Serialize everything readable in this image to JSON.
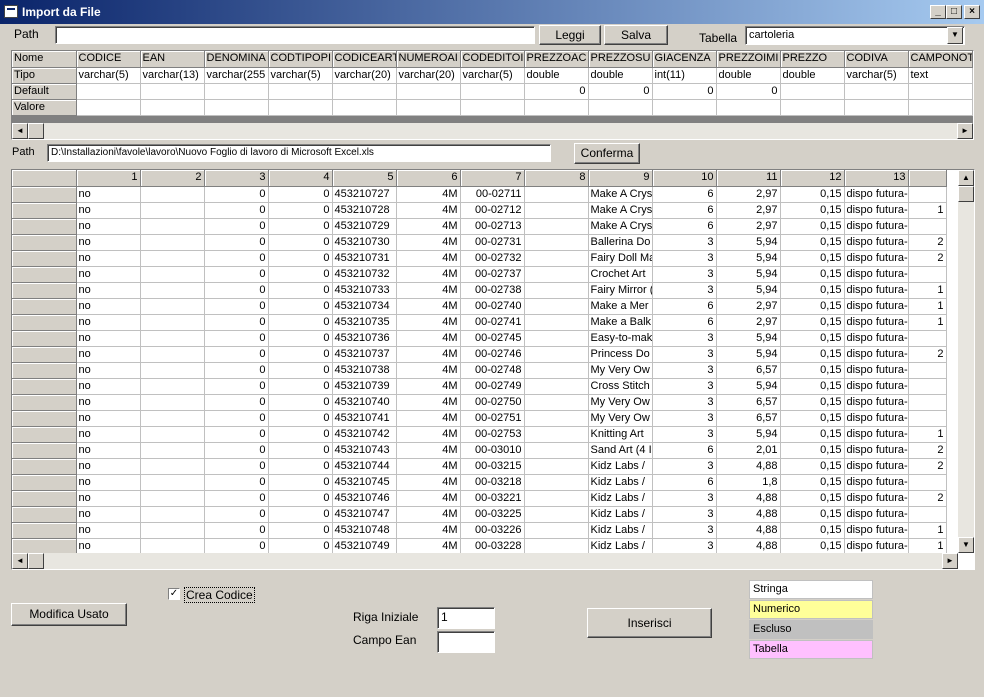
{
  "window": {
    "title": "Import da File"
  },
  "top": {
    "path_label": "Path",
    "path_value": "",
    "leggi_label": "Leggi",
    "salva_label": "Salva",
    "tabella_label": "Tabella",
    "tabella_value": "cartoleria"
  },
  "schema": {
    "row_labels": [
      "Nome",
      "Tipo",
      "Default",
      "Valore"
    ],
    "columns": [
      {
        "nome": "CODICE",
        "tipo": "varchar(5)",
        "default": ""
      },
      {
        "nome": "EAN",
        "tipo": "varchar(13)",
        "default": ""
      },
      {
        "nome": "DENOMINA",
        "tipo": "varchar(255",
        "default": ""
      },
      {
        "nome": "CODTIPOPI",
        "tipo": "varchar(5)",
        "default": ""
      },
      {
        "nome": "CODICEART",
        "tipo": "varchar(20)",
        "default": ""
      },
      {
        "nome": "NUMEROAI",
        "tipo": "varchar(20)",
        "default": ""
      },
      {
        "nome": "CODEDITOI",
        "tipo": "varchar(5)",
        "default": ""
      },
      {
        "nome": "PREZZOAC",
        "tipo": "double",
        "default": "0"
      },
      {
        "nome": "PREZZOSU",
        "tipo": "double",
        "default": "0"
      },
      {
        "nome": "GIACENZA",
        "tipo": "int(11)",
        "default": "0"
      },
      {
        "nome": "PREZZOIMI",
        "tipo": "double",
        "default": "0"
      },
      {
        "nome": "PREZZO",
        "tipo": "double",
        "default": ""
      },
      {
        "nome": "CODIVA",
        "tipo": "varchar(5)",
        "default": ""
      },
      {
        "nome": "CAMPONOT",
        "tipo": "text",
        "default": ""
      }
    ]
  },
  "file": {
    "path_label": "Path",
    "path_value": "D:\\Installazioni\\favole\\lavoro\\Nuovo Foglio di lavoro di Microsoft Excel.xls",
    "conferma_label": "Conferma"
  },
  "data": {
    "headers": [
      "",
      "1",
      "2",
      "3",
      "4",
      "5",
      "6",
      "7",
      "8",
      "9",
      "10",
      "11",
      "12",
      "13",
      ""
    ],
    "rows": [
      [
        "",
        "no",
        "",
        "0",
        "0",
        "453210727",
        "4M",
        "00-02711",
        "",
        "Make A Crys",
        "6",
        "2,97",
        "0,15",
        "dispo futura-",
        ""
      ],
      [
        "",
        "no",
        "",
        "0",
        "0",
        "453210728",
        "4M",
        "00-02712",
        "",
        "Make A Crys",
        "6",
        "2,97",
        "0,15",
        "dispo futura-",
        "1"
      ],
      [
        "",
        "no",
        "",
        "0",
        "0",
        "453210729",
        "4M",
        "00-02713",
        "",
        "Make A Crys",
        "6",
        "2,97",
        "0,15",
        "dispo futura-",
        ""
      ],
      [
        "",
        "no",
        "",
        "0",
        "0",
        "453210730",
        "4M",
        "00-02731",
        "",
        "Ballerina Do",
        "3",
        "5,94",
        "0,15",
        "dispo futura-",
        "2"
      ],
      [
        "",
        "no",
        "",
        "0",
        "0",
        "453210731",
        "4M",
        "00-02732",
        "",
        "Fairy Doll Ma",
        "3",
        "5,94",
        "0,15",
        "dispo futura-",
        "2"
      ],
      [
        "",
        "no",
        "",
        "0",
        "0",
        "453210732",
        "4M",
        "00-02737",
        "",
        "Crochet Art",
        "3",
        "5,94",
        "0,15",
        "dispo futura-",
        ""
      ],
      [
        "",
        "no",
        "",
        "0",
        "0",
        "453210733",
        "4M",
        "00-02738",
        "",
        "Fairy Mirror (",
        "3",
        "5,94",
        "0,15",
        "dispo futura-",
        "1"
      ],
      [
        "",
        "no",
        "",
        "0",
        "0",
        "453210734",
        "4M",
        "00-02740",
        "",
        "Make a Mer",
        "6",
        "2,97",
        "0,15",
        "dispo futura-",
        "1"
      ],
      [
        "",
        "no",
        "",
        "0",
        "0",
        "453210735",
        "4M",
        "00-02741",
        "",
        "Make a Balk",
        "6",
        "2,97",
        "0,15",
        "dispo futura-",
        "1"
      ],
      [
        "",
        "no",
        "",
        "0",
        "0",
        "453210736",
        "4M",
        "00-02745",
        "",
        "Easy-to-mak",
        "3",
        "5,94",
        "0,15",
        "dispo futura-",
        ""
      ],
      [
        "",
        "no",
        "",
        "0",
        "0",
        "453210737",
        "4M",
        "00-02746",
        "",
        "Princess Do",
        "3",
        "5,94",
        "0,15",
        "dispo futura-",
        "2"
      ],
      [
        "",
        "no",
        "",
        "0",
        "0",
        "453210738",
        "4M",
        "00-02748",
        "",
        "My Very Ow",
        "3",
        "6,57",
        "0,15",
        "dispo futura-",
        ""
      ],
      [
        "",
        "no",
        "",
        "0",
        "0",
        "453210739",
        "4M",
        "00-02749",
        "",
        "Cross Stitch",
        "3",
        "5,94",
        "0,15",
        "dispo futura-",
        ""
      ],
      [
        "",
        "no",
        "",
        "0",
        "0",
        "453210740",
        "4M",
        "00-02750",
        "",
        "My Very Ow",
        "3",
        "6,57",
        "0,15",
        "dispo futura-",
        ""
      ],
      [
        "",
        "no",
        "",
        "0",
        "0",
        "453210741",
        "4M",
        "00-02751",
        "",
        "My Very Ow",
        "3",
        "6,57",
        "0,15",
        "dispo futura-",
        ""
      ],
      [
        "",
        "no",
        "",
        "0",
        "0",
        "453210742",
        "4M",
        "00-02753",
        "",
        "Knitting Art",
        "3",
        "5,94",
        "0,15",
        "dispo futura-",
        "1"
      ],
      [
        "",
        "no",
        "",
        "0",
        "0",
        "453210743",
        "4M",
        "00-03010",
        "",
        "Sand Art (4 I",
        "6",
        "2,01",
        "0,15",
        "dispo futura-",
        "2"
      ],
      [
        "",
        "no",
        "",
        "0",
        "0",
        "453210744",
        "4M",
        "00-03215",
        "",
        "Kidz Labs /",
        "3",
        "4,88",
        "0,15",
        "dispo futura-",
        "2"
      ],
      [
        "",
        "no",
        "",
        "0",
        "0",
        "453210745",
        "4M",
        "00-03218",
        "",
        "Kidz Labs /",
        "6",
        "1,8",
        "0,15",
        "dispo futura-",
        ""
      ],
      [
        "",
        "no",
        "",
        "0",
        "0",
        "453210746",
        "4M",
        "00-03221",
        "",
        "Kidz Labs /",
        "3",
        "4,88",
        "0,15",
        "dispo futura-",
        "2"
      ],
      [
        "",
        "no",
        "",
        "0",
        "0",
        "453210747",
        "4M",
        "00-03225",
        "",
        "Kidz Labs /",
        "3",
        "4,88",
        "0,15",
        "dispo futura-",
        ""
      ],
      [
        "",
        "no",
        "",
        "0",
        "0",
        "453210748",
        "4M",
        "00-03226",
        "",
        "Kidz Labs /",
        "3",
        "4,88",
        "0,15",
        "dispo futura-",
        "1"
      ],
      [
        "",
        "no",
        "",
        "0",
        "0",
        "453210749",
        "4M",
        "00-03228",
        "",
        "Kidz Labs /",
        "3",
        "4,88",
        "0,15",
        "dispo futura-",
        "1"
      ]
    ]
  },
  "bottom": {
    "modifica_label": "Modifica Usato",
    "crea_codice_label": "Crea Codice",
    "crea_codice_checked": "✓",
    "riga_iniziale_label": "Riga Iniziale",
    "riga_iniziale_value": "1",
    "campo_ean_label": "Campo Ean",
    "campo_ean_value": "",
    "inserisci_label": "Inserisci"
  },
  "legend": [
    {
      "label": "Stringa",
      "color": "#ffffff"
    },
    {
      "label": "Numerico",
      "color": "#ffff99"
    },
    {
      "label": "Escluso",
      "color": "#c0c0c0"
    },
    {
      "label": "Tabella",
      "color": "#ffc0ff"
    }
  ]
}
